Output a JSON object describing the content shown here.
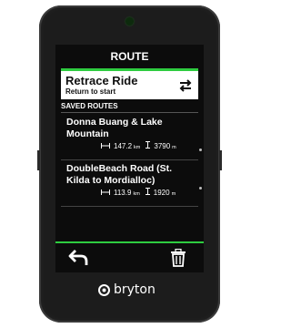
{
  "screen": {
    "title": "ROUTE",
    "retrace": {
      "name": "Retrace Ride",
      "subtitle": "Return to start"
    },
    "section_label": "SAVED ROUTES",
    "routes": [
      {
        "name": "Donna Buang & Lake Mountain",
        "distance": "147.2",
        "distance_unit": "km",
        "elevation": "3790",
        "elevation_unit": "m"
      },
      {
        "name": "DoubleBeach Road (St. Kilda to Mordialloc)",
        "distance": "113.9",
        "distance_unit": "km",
        "elevation": "1920",
        "elevation_unit": "m"
      }
    ]
  },
  "brand": {
    "name": "bryton"
  },
  "colors": {
    "accent": "#2ecc40",
    "screen_bg": "#0c0c0c",
    "device": "#1c1c1c"
  },
  "icons": [
    "swap-arrows-icon",
    "distance-icon",
    "elevation-icon",
    "back-arrow-icon",
    "trash-icon",
    "bryton-logo-icon"
  ]
}
